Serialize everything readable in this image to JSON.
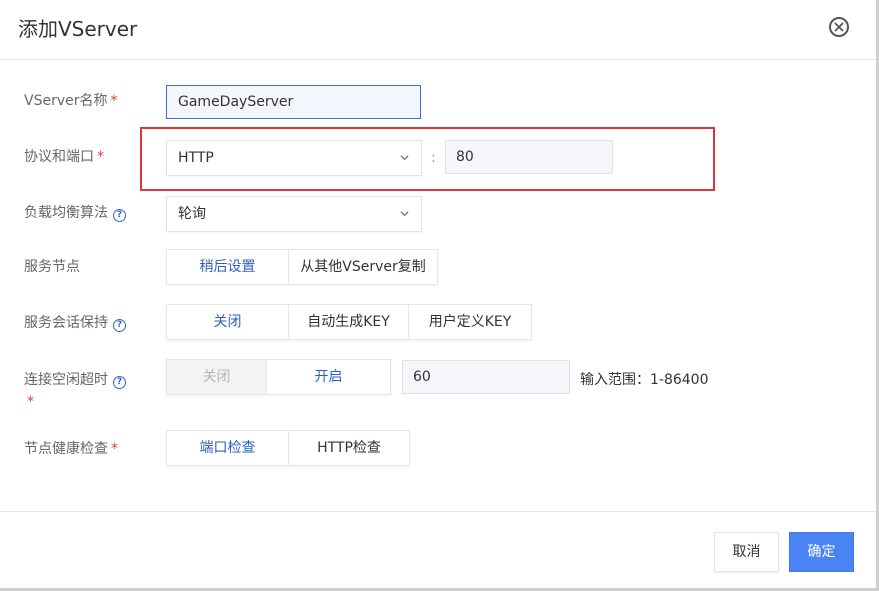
{
  "dialog": {
    "title": "添加VServer",
    "close_icon": "close-circle-icon"
  },
  "form": {
    "name": {
      "label": "VServer名称",
      "required_mark": "*",
      "value": "GameDayServer"
    },
    "protocol_port": {
      "label": "协议和端口",
      "required_mark": "*",
      "protocol_value": "HTTP",
      "separator": ":",
      "port_value": "80"
    },
    "lb_algorithm": {
      "label": "负载均衡算法",
      "help_icon": "?",
      "value": "轮询"
    },
    "backend_nodes": {
      "label": "服务节点",
      "options": [
        "稍后设置",
        "从其他VServer复制"
      ]
    },
    "session_persistence": {
      "label": "服务会话保持",
      "help_icon": "?",
      "options": [
        "关闭",
        "自动生成KEY",
        "用户定义KEY"
      ]
    },
    "idle_timeout": {
      "label": "连接空闲超时",
      "help_icon": "?",
      "required_mark": "*",
      "options": [
        "关闭",
        "开启"
      ],
      "value": "60",
      "hint": "输入范围：1-86400"
    },
    "health_check": {
      "label": "节点健康检查",
      "required_mark": "*",
      "options": [
        "端口检查",
        "HTTP检查"
      ]
    }
  },
  "footer": {
    "cancel_label": "取消",
    "ok_label": "确定"
  },
  "colors": {
    "accent": "#4a84f3",
    "highlight_border": "#d9363e",
    "required": "#e43e3e"
  }
}
